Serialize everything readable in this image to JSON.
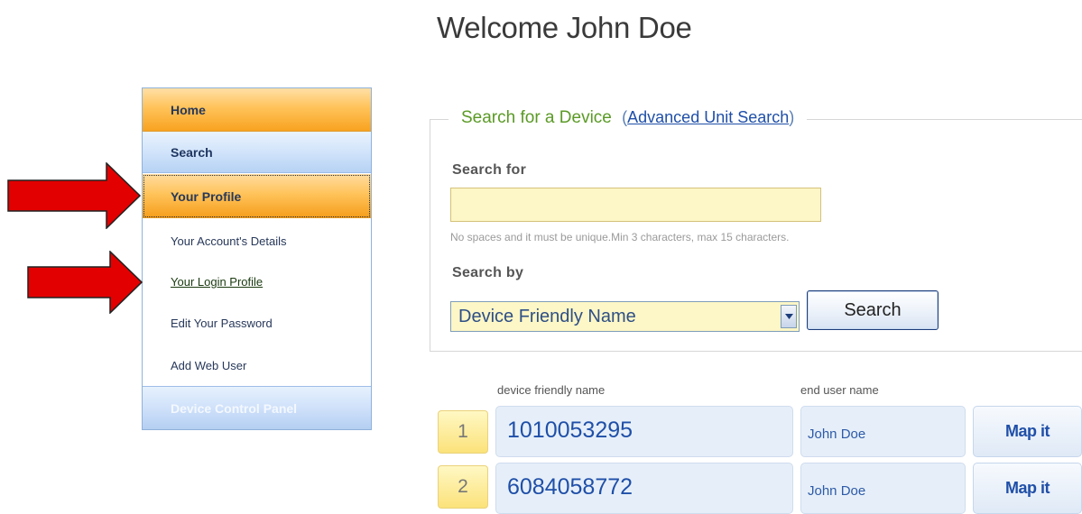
{
  "header": {
    "welcome": "Welcome John Doe"
  },
  "nav": {
    "home": "Home",
    "search": "Search",
    "profile": "Your Profile",
    "sub_items": [
      "Your Account's Details",
      "Your Login Profile",
      "Edit Your Password",
      "Add Web User"
    ],
    "device_panel": "Device Control Panel"
  },
  "search": {
    "legend": "Search for a Device",
    "advanced_open": "(",
    "advanced_link": "Advanced Unit Search",
    "advanced_close": ")",
    "search_for_label": "Search for",
    "search_for_value": "",
    "hint": "No spaces and it must be unique.Min 3 characters, max 15 characters.",
    "search_by_label": "Search by",
    "search_by_selected": "Device Friendly Name",
    "button": "Search"
  },
  "results": {
    "columns": [
      "device friendly name",
      "end user name"
    ],
    "rows": [
      {
        "num": "1",
        "device": "1010053295",
        "user": "John Doe",
        "action": "Map it"
      },
      {
        "num": "2",
        "device": "6084058772",
        "user": "John Doe",
        "action": "Map it"
      }
    ]
  },
  "colors": {
    "accent_orange": "#ffc35a",
    "nav_blue": "#cfe2fa",
    "input_yellow": "#fdf6c6",
    "arrow_red": "#e30000",
    "legend_green": "#5a9a25",
    "link_blue": "#1f4fa8"
  }
}
